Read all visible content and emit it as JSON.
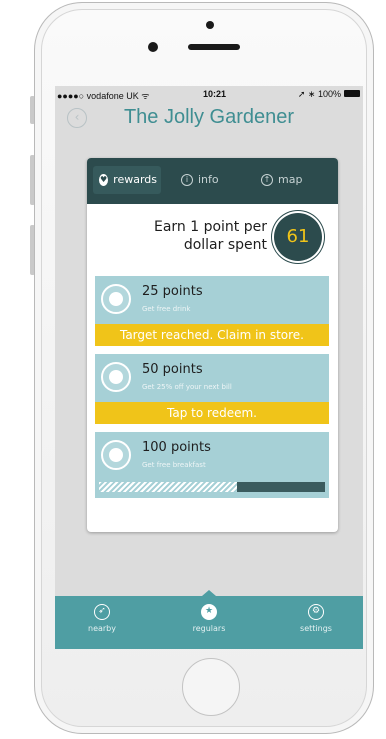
{
  "status_bar": {
    "carrier": "●●●●○ vodafone UK ᯤ",
    "time": "10:21",
    "right": "➚ ∗ 100%"
  },
  "header": {
    "title": "The Jolly Gardener",
    "back_icon": "chevron-left-icon"
  },
  "tabs": [
    {
      "label": "rewards",
      "icon": "heart-icon",
      "active": true
    },
    {
      "label": "info",
      "icon": "info-icon",
      "active": false
    },
    {
      "label": "map",
      "icon": "location-icon",
      "active": false
    }
  ],
  "earn": {
    "line1": "Earn 1 point per",
    "line2": "dollar spent"
  },
  "score": "61",
  "rewards": [
    {
      "points": "25 points",
      "desc": "Get free drink",
      "action": "Target reached. Claim in store.",
      "icon": "beer-icon"
    },
    {
      "points": "50 points",
      "desc": "Get 25% off your next bill",
      "action": "Tap to redeem.",
      "icon": "money-icon"
    },
    {
      "points": "100 points",
      "desc": "Get free breakfast",
      "progress": 0.61,
      "icon": "food-icon"
    }
  ],
  "nav": [
    {
      "label": "nearby",
      "icon": "compass-icon",
      "active": false
    },
    {
      "label": "regulars",
      "icon": "star-icon",
      "active": true
    },
    {
      "label": "settings",
      "icon": "gears-icon",
      "active": false
    }
  ],
  "colors": {
    "accent": "#3f8e92",
    "dark": "#2c4b4d",
    "highlight": "#f0c419",
    "reward_bg": "#a6d0d6",
    "nav_bg": "#4f9ea3"
  }
}
